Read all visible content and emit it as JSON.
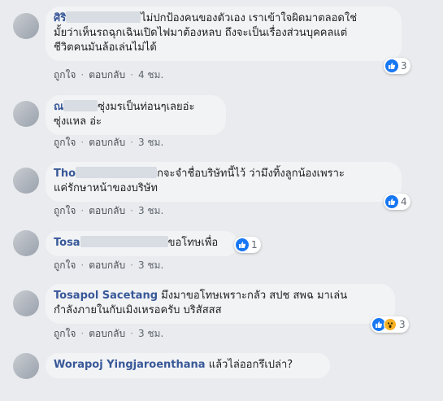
{
  "comments": [
    {
      "author": "ศิริ",
      "lines": [
        "ไม่ปกป้องคนของตัวเอง เราเข้าใจผิดมาตลอดใช่",
        "มั้ยว่าเห็นรถฉุกเฉินเปิดไฟมาต้องหลบ ถึงจะเป็นเรื่องส่วนบุคคลแต่",
        "ชีวิตคนมันล้อเล่นไม่ได้"
      ],
      "reaction_count": "3",
      "like_label": "ถูกใจ",
      "reply_label": "ตอบกลับ",
      "time": "4 ชม."
    },
    {
      "author": "ณ",
      "lines": [
        "ซุ่งมรเป็นท่อนๆเลยอ่ะ",
        "ซุ่งแหล อ่ะ"
      ],
      "like_label": "ถูกใจ",
      "reply_label": "ตอบกลับ",
      "time": "3 ชม."
    },
    {
      "author": "Tho",
      "lines": [
        "กจะจำชื่อบริษัทนี้ไว้ ว่ามึงทิ้งลูกน้องเพราะ",
        "แค่รักษาหน้าของบริษัท"
      ],
      "reaction_count": "4",
      "like_label": "ถูกใจ",
      "reply_label": "ตอบกลับ",
      "time": "3 ชม."
    },
    {
      "author": "Tosa",
      "lines": [
        "ขอโทษเพื่อ"
      ],
      "reaction_count": "1",
      "like_label": "ถูกใจ",
      "reply_label": "ตอบกลับ",
      "time": "3 ชม."
    },
    {
      "author": "Tosapol Sacetang",
      "lines": [
        "มึงมาขอโทษเพราะกลัว สปช สพฉ มาเล่น",
        "กำลังภายในกับเมิงเหรอครับ บริสัสสส"
      ],
      "reaction_count": "3",
      "like_label": "ถูกใจ",
      "reply_label": "ตอบกลับ",
      "time": "3 ชม."
    },
    {
      "author": "Worapoj Yingjaroenthana",
      "lines": [
        "แล้วไล่ออกรึเปล่า?"
      ]
    }
  ],
  "colors": {
    "author_link": "#385898",
    "like_blue": "#1877f2",
    "wow_yellow": "#f7b125",
    "bubble_bg": "#f2f3f5",
    "page_bg": "#e9ebee"
  }
}
